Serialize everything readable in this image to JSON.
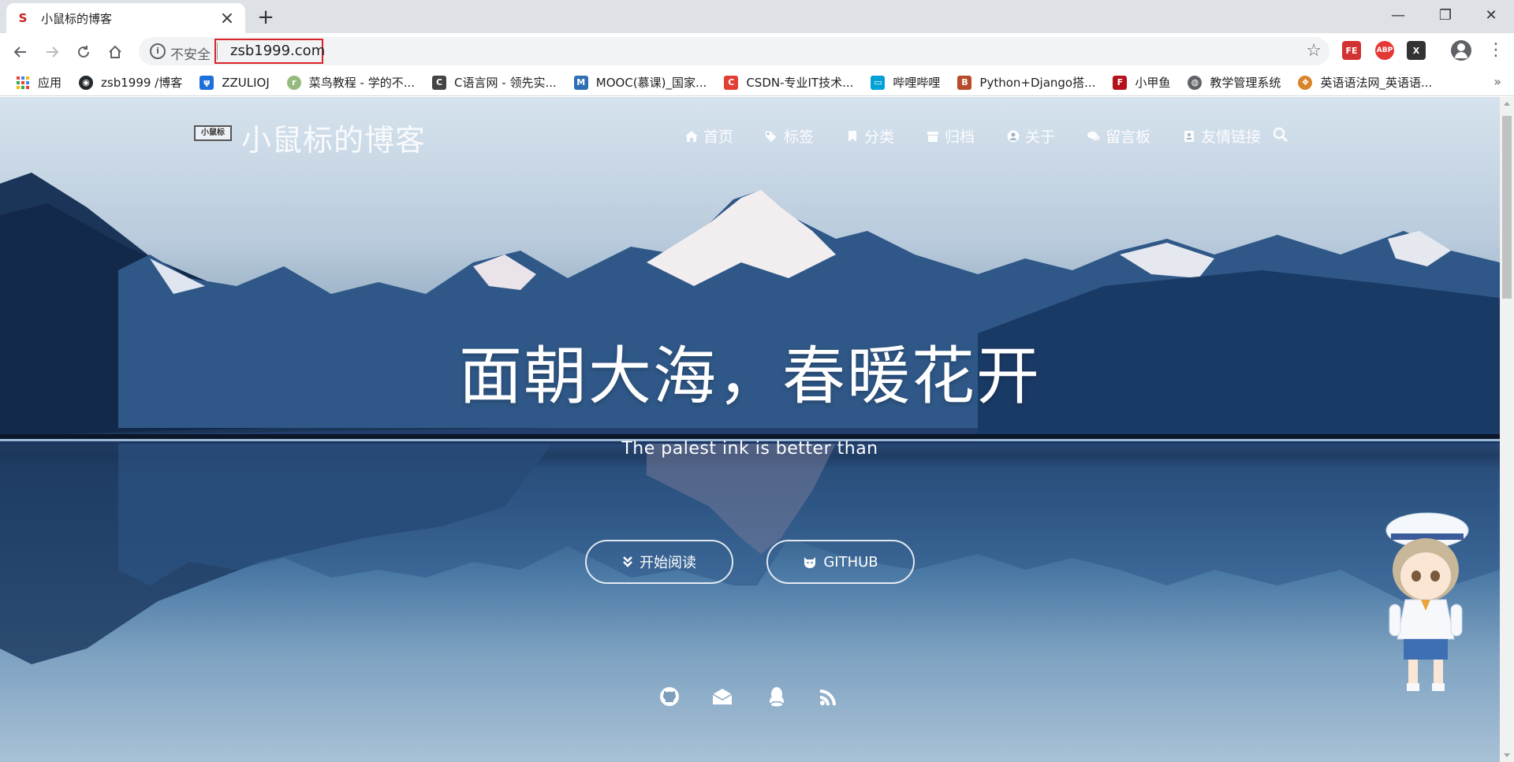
{
  "browser": {
    "tab": {
      "title": "小鼠标的博客",
      "close": "×",
      "favicon": "S"
    },
    "new_tab": "+",
    "window": {
      "minimize": "—",
      "restore": "❐",
      "close": "✕"
    },
    "omnibox": {
      "security_label": "不安全",
      "url": "zsb1999.com"
    },
    "extensions": [
      {
        "name": "FE",
        "color": "#d23232"
      },
      {
        "name": "ABP",
        "color": "#e53935"
      },
      {
        "name": "X",
        "color": "#333333"
      }
    ],
    "bookmarks": [
      {
        "label": "应用",
        "icon": "apps-grid-icon",
        "color": "#4285f4"
      },
      {
        "label": "zsb1999 /博客",
        "icon": "github-icon",
        "color": "#24292e"
      },
      {
        "label": "ZZULIOJ",
        "icon": "zzulioj-icon",
        "color": "#1e6fd9"
      },
      {
        "label": "菜鸟教程 - 学的不...",
        "icon": "runoob-icon",
        "color": "#96b97d"
      },
      {
        "label": "C语言网 - 领先实...",
        "icon": "dotcpp-icon",
        "color": "#444444"
      },
      {
        "label": "MOOC(慕课)_国家...",
        "icon": "mooc-icon",
        "color": "#2c6fb3"
      },
      {
        "label": "CSDN-专业IT技术...",
        "icon": "csdn-icon",
        "color": "#e33e33"
      },
      {
        "label": "哔哩哔哩",
        "icon": "bilibili-icon",
        "color": "#00a1d6"
      },
      {
        "label": "Python+Django搭...",
        "icon": "django-icon",
        "color": "#b84b2b"
      },
      {
        "label": "小甲鱼",
        "icon": "fishc-icon",
        "color": "#b5121b"
      },
      {
        "label": "教学管理系统",
        "icon": "globe-icon",
        "color": "#5f6368"
      },
      {
        "label": "英语语法网_英语语...",
        "icon": "grammar-icon",
        "color": "#d9842b"
      }
    ],
    "bookmarks_more": "»"
  },
  "blog": {
    "logo_text": "小鼠标",
    "site_title": "小鼠标的博客",
    "menu": [
      {
        "label": "首页",
        "icon": "home-icon"
      },
      {
        "label": "标签",
        "icon": "tags-icon"
      },
      {
        "label": "分类",
        "icon": "bookmark-icon"
      },
      {
        "label": "归档",
        "icon": "archive-icon"
      },
      {
        "label": "关于",
        "icon": "user-icon"
      },
      {
        "label": "留言板",
        "icon": "comments-icon"
      },
      {
        "label": "友情链接",
        "icon": "address-card-icon"
      }
    ],
    "hero_title": "面朝大海，春暖花开",
    "hero_subtitle": "The palest ink is better than",
    "buttons": [
      {
        "label": "开始阅读",
        "icon": "double-chevron-down-icon"
      },
      {
        "label": "GITHUB",
        "icon": "github-alt-icon"
      }
    ],
    "social": [
      "github-icon",
      "envelope-icon",
      "qq-icon",
      "rss-icon"
    ]
  }
}
